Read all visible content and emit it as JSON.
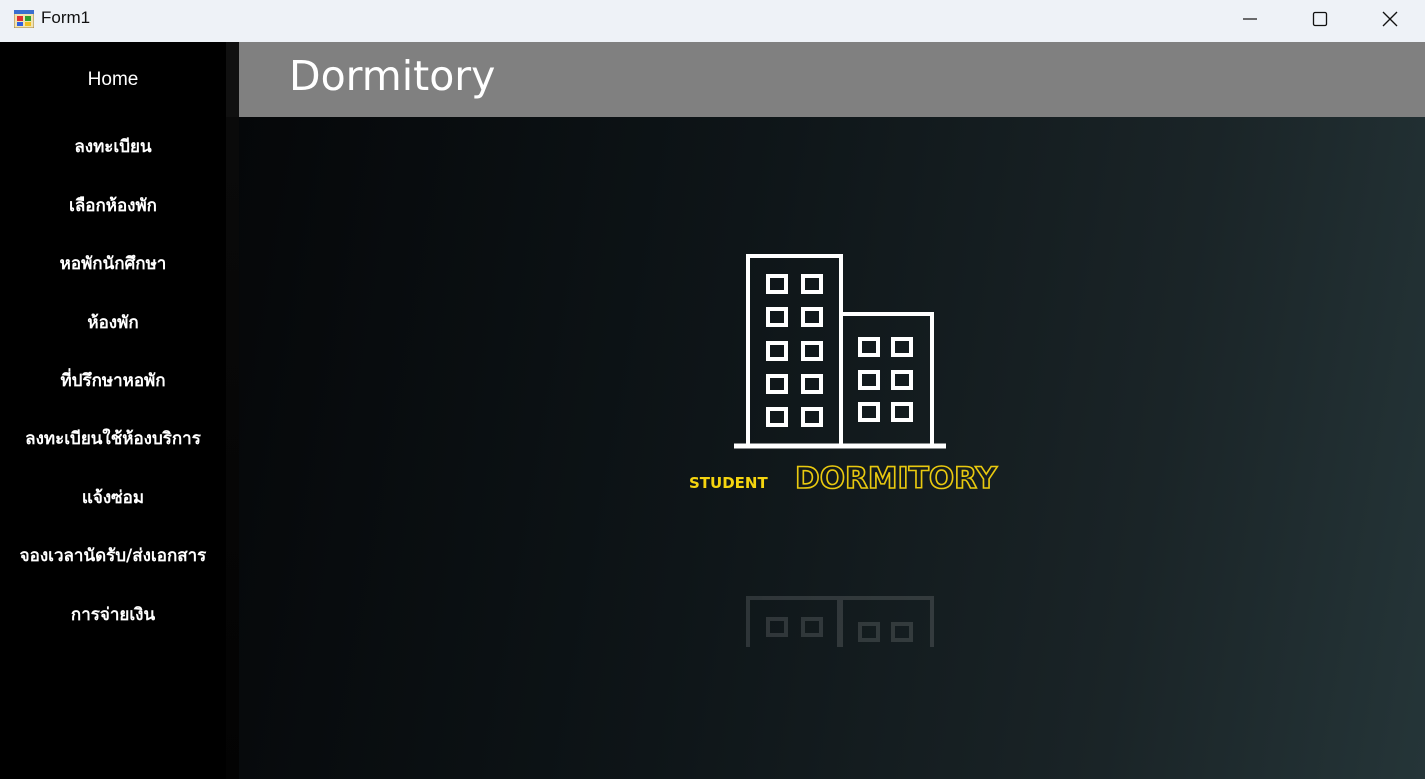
{
  "window": {
    "title": "Form1"
  },
  "sidebar": {
    "home_label": "Home",
    "items": [
      {
        "label": "ลงทะเบียน"
      },
      {
        "label": "เลือกห้องพัก"
      },
      {
        "label": "หอพักนักศึกษา"
      },
      {
        "label": "ห้องพัก"
      },
      {
        "label": "ที่ปรึกษาหอพัก"
      },
      {
        "label": "ลงทะเบียนใช้ห้องบริการ"
      },
      {
        "label": "แจ้งซ่อม"
      },
      {
        "label": "จองเวลานัดรับ/ส่งเอกสาร"
      },
      {
        "label": "การจ่ายเงิน"
      }
    ]
  },
  "header": {
    "title": "Dormitory"
  },
  "logo": {
    "word_small": "STUDENT",
    "word_large": "DORMITORY",
    "accent_color": "#f5d40f",
    "icon": "building-icon"
  },
  "colors": {
    "header_bg": "#808080",
    "sidebar_bg": "#000000",
    "titlebar_bg": "#eef2f7"
  }
}
